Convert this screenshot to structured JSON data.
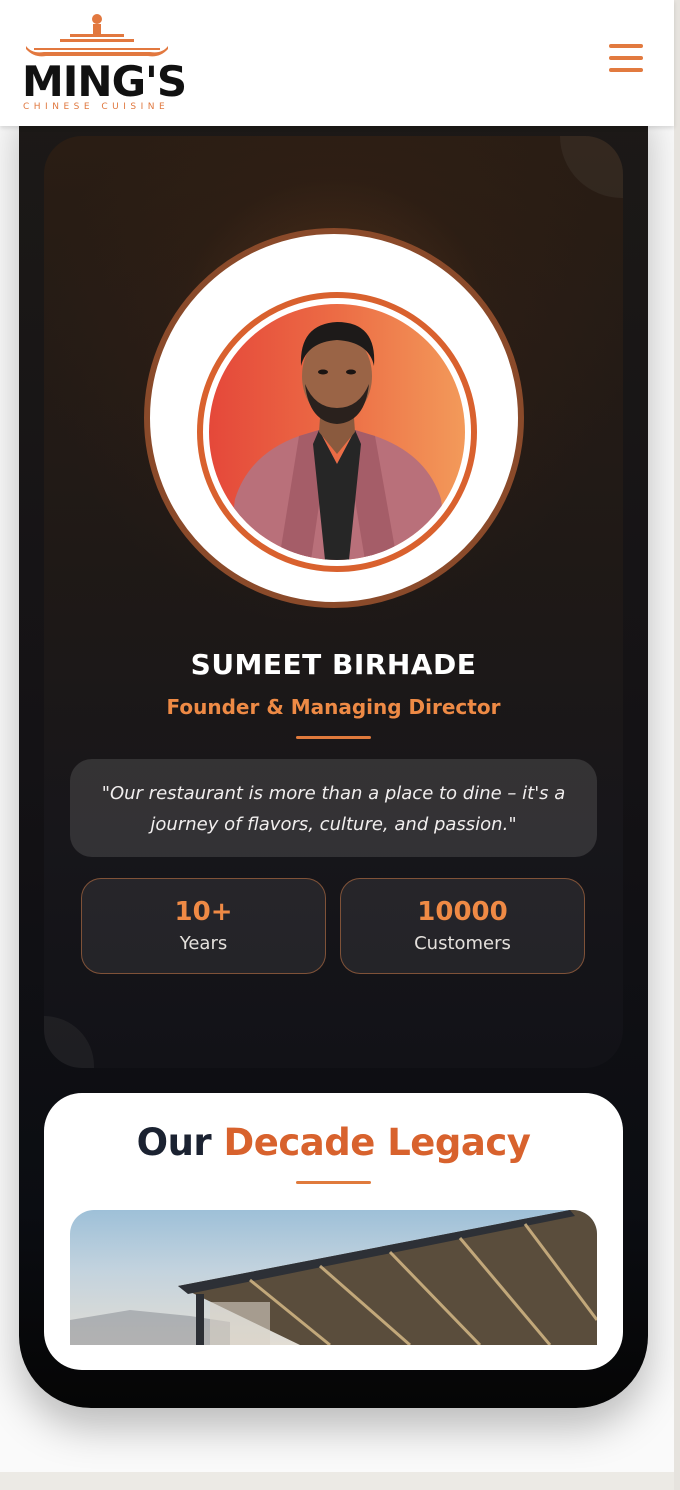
{
  "header": {
    "logo_text": "MING'S",
    "logo_subtitle": "CHINESE CUISINE",
    "menu_icon": "hamburger-icon"
  },
  "profile": {
    "name": "SUMEET BIRHADE",
    "role": "Founder & Managing Director",
    "quote": "\"Our restaurant is more than a place to dine – it's a journey of flavors, culture, and passion.\"",
    "stats": [
      {
        "value": "10+",
        "label": "Years"
      },
      {
        "value": "10000",
        "label": "Customers"
      }
    ]
  },
  "legacy": {
    "title_prefix": "Our",
    "title_accent": "Decade Legacy"
  },
  "colors": {
    "accent": "#e07a3c",
    "dark_card": "#1c1917",
    "title_dark": "#1b2231"
  }
}
